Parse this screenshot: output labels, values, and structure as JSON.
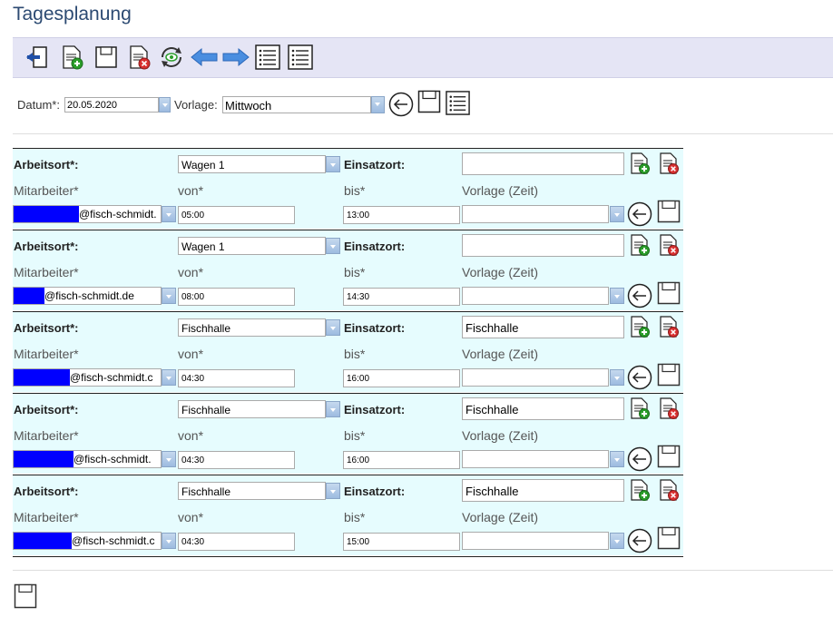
{
  "page": {
    "title": "Tagesplanung"
  },
  "toolbar": {
    "buttons": [
      {
        "name": "back-exit-button",
        "icon": "exit-arrow-icon"
      },
      {
        "name": "new-document-button",
        "icon": "doc-add-icon"
      },
      {
        "name": "save-button",
        "icon": "floppy-icon"
      },
      {
        "name": "delete-document-button",
        "icon": "doc-delete-icon"
      },
      {
        "name": "refresh-button",
        "icon": "refresh-eye-icon"
      },
      {
        "name": "previous-button",
        "icon": "arrow-left-icon"
      },
      {
        "name": "next-button",
        "icon": "arrow-right-icon"
      },
      {
        "name": "list-button",
        "icon": "list-icon"
      },
      {
        "name": "list-alt-button",
        "icon": "list-icon"
      }
    ]
  },
  "filter": {
    "datum_label": "Datum*:",
    "datum_value": "20.05.2020",
    "vorlage_label": "Vorlage:",
    "vorlage_value": "Mittwoch"
  },
  "labels": {
    "arbeitsort": "Arbeitsort*:",
    "einsatzort": "Einsatzort:",
    "mitarbeiter": "Mitarbeiter*",
    "von": "von*",
    "bis": "bis*",
    "vorlage_zeit": "Vorlage (Zeit)"
  },
  "rows": [
    {
      "arbeitsort": "Wagen 1",
      "einsatzort": "",
      "email": "@fisch-schmidt.",
      "von": "05:00",
      "bis": "13:00",
      "vorlage": ""
    },
    {
      "arbeitsort": "Wagen 1",
      "einsatzort": "",
      "email": "@fisch-schmidt.de",
      "von": "08:00",
      "bis": "14:30",
      "vorlage": ""
    },
    {
      "arbeitsort": "Fischhalle",
      "einsatzort": "Fischhalle",
      "email": "@fisch-schmidt.c",
      "von": "04:30",
      "bis": "16:00",
      "vorlage": ""
    },
    {
      "arbeitsort": "Fischhalle",
      "einsatzort": "Fischhalle",
      "email": "@fisch-schmidt.",
      "von": "04:30",
      "bis": "16:00",
      "vorlage": ""
    },
    {
      "arbeitsort": "Fischhalle",
      "einsatzort": "Fischhalle",
      "email": "@fisch-schmidt.c",
      "von": "04:30",
      "bis": "15:00",
      "vorlage": ""
    }
  ],
  "colors": {
    "accent": "#2c4a72",
    "toolbar_bg": "#e5e5f5",
    "row_bg": "#e6fcfe",
    "redaction": "#0000ff"
  }
}
